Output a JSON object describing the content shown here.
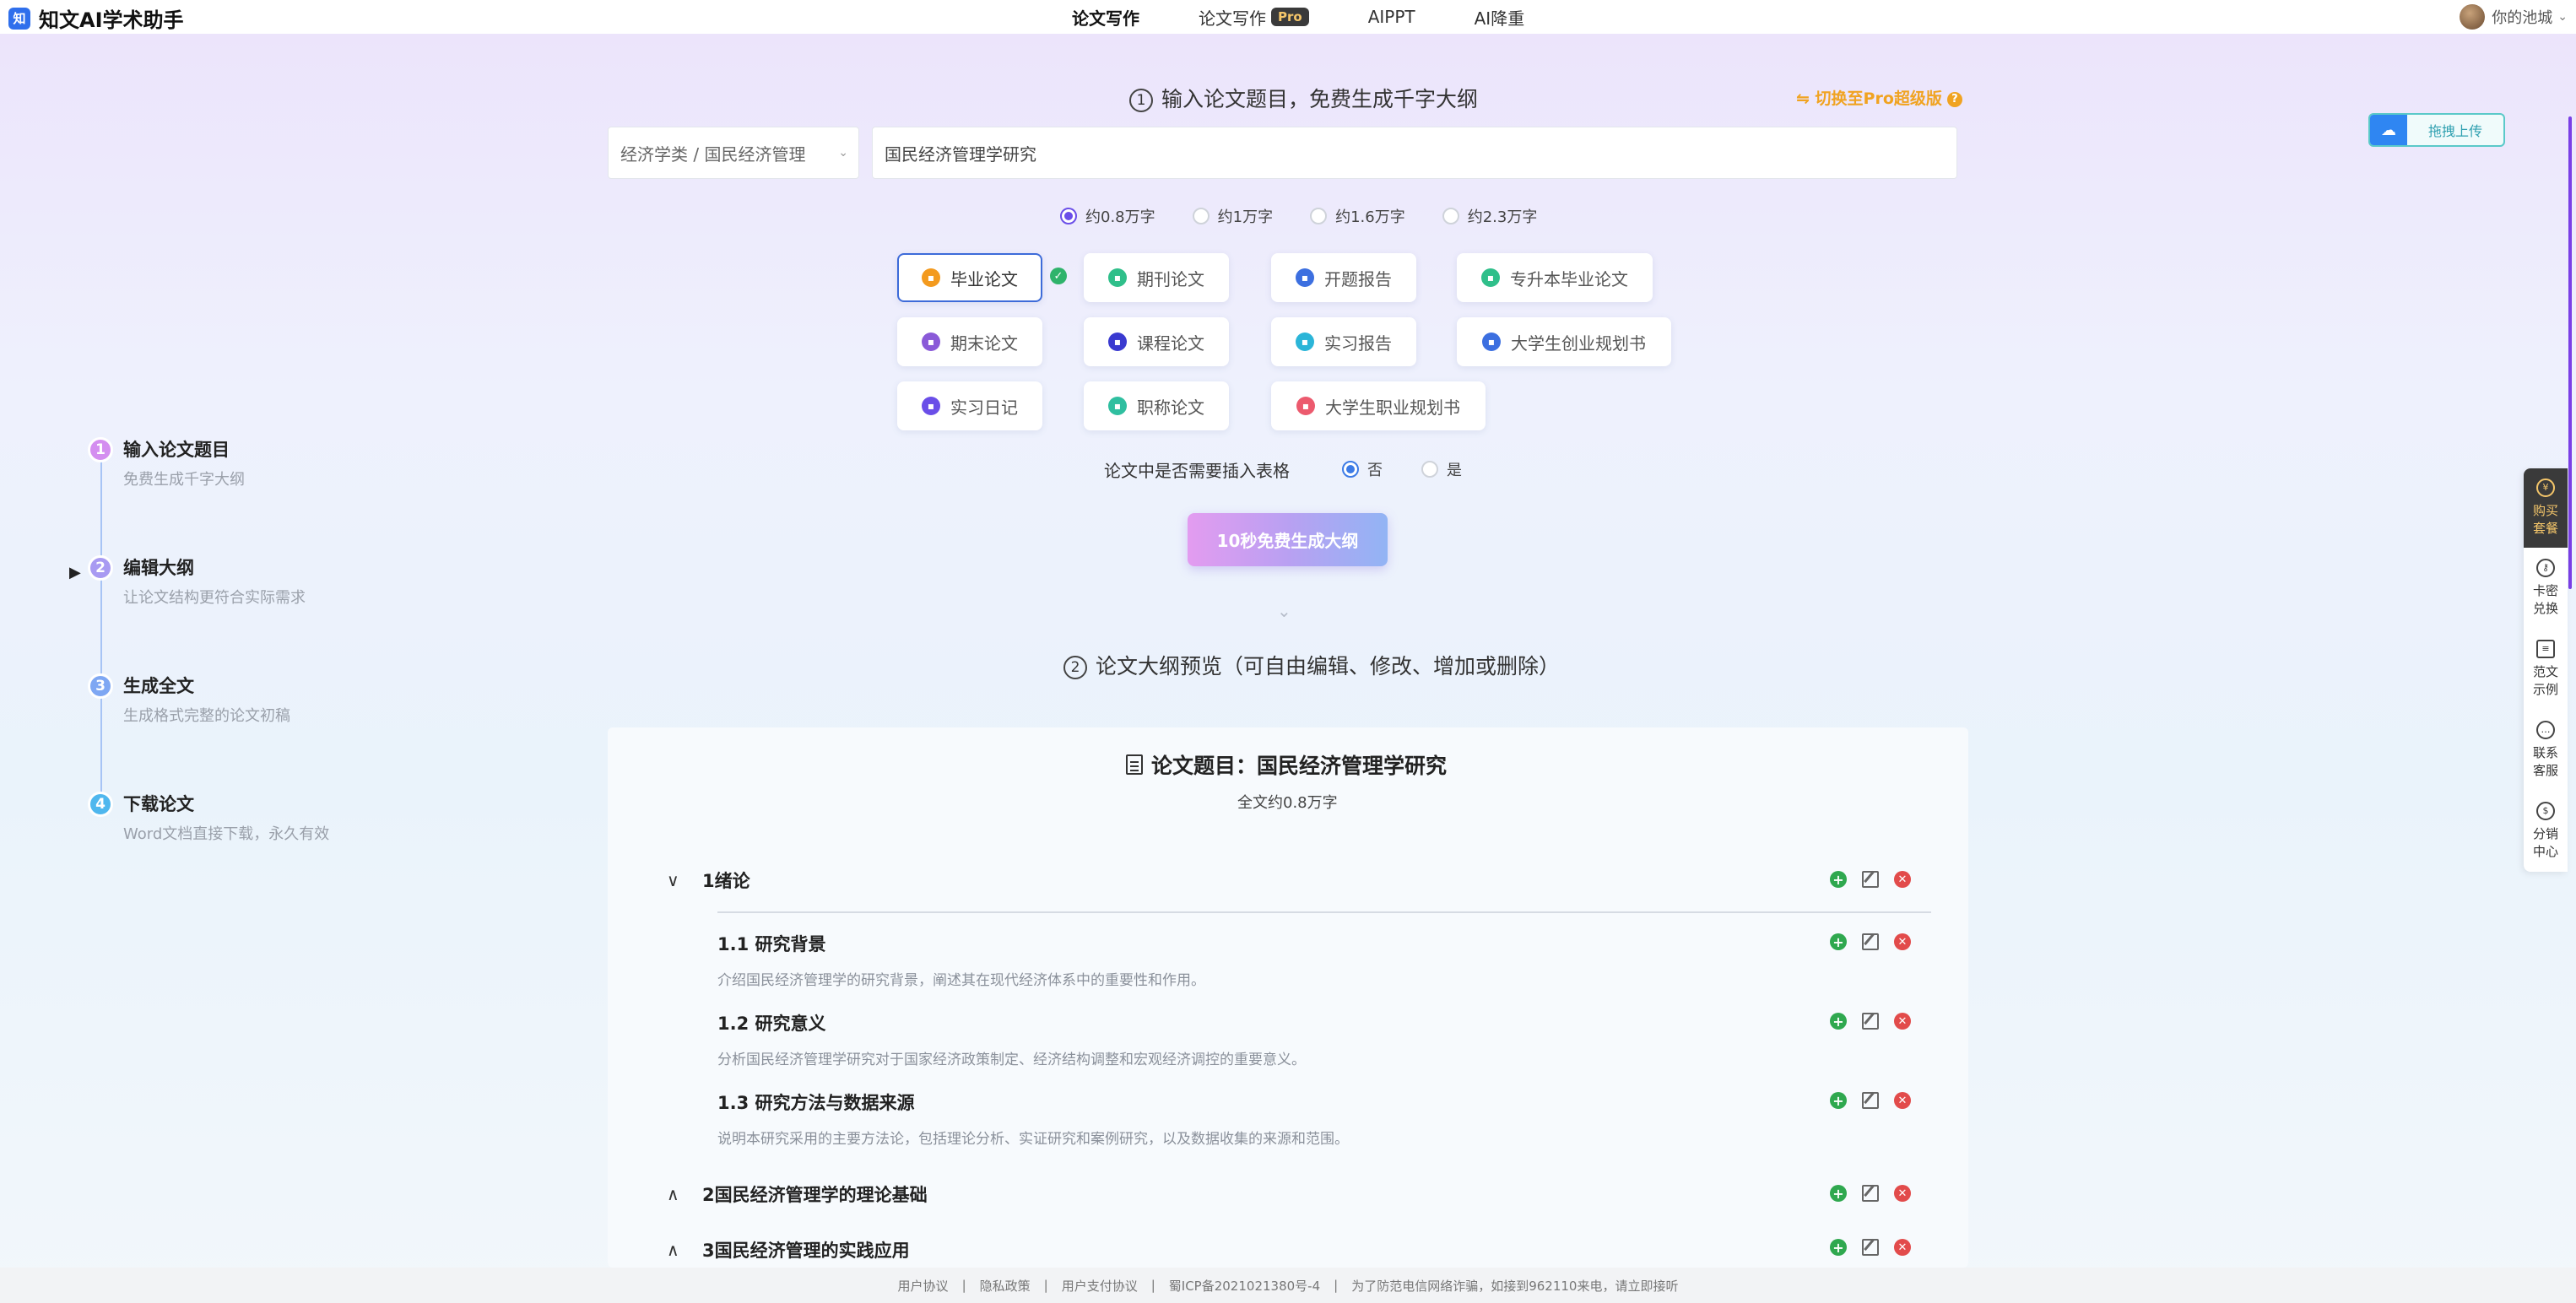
{
  "brand": {
    "logo_glyph": "知",
    "name": "知文AI学术助手",
    "accent": "#2f6fec"
  },
  "nav": [
    {
      "label": "论文写作",
      "active": true
    },
    {
      "label": "论文写作",
      "badge": "Pro"
    },
    {
      "label": "AIPPT"
    },
    {
      "label": "AI降重"
    }
  ],
  "user": {
    "name": "你的池城"
  },
  "steps": [
    {
      "num": "1",
      "title": "输入论文题目",
      "desc": "免费生成千字大纲",
      "color": "#d48ef0"
    },
    {
      "num": "2",
      "title": "编辑大纲",
      "desc": "让论文结构更符合实际需求",
      "color": "#a89af2"
    },
    {
      "num": "3",
      "title": "生成全文",
      "desc": "生成格式完整的论文初稿",
      "color": "#7ea7f3"
    },
    {
      "num": "4",
      "title": "下载论文",
      "desc": "Word文档直接下载，永久有效",
      "color": "#4fb7ee"
    }
  ],
  "step1": {
    "num": "1",
    "title": "输入论文题目，免费生成千字大纲",
    "pro_switch": "切换至Pro超级版",
    "pro_help": "?",
    "subject": "经济学类 / 国民经济管理",
    "topic_value": "国民经济管理学研究",
    "lengths": [
      {
        "label": "约0.8万字",
        "selected": true
      },
      {
        "label": "约1万字"
      },
      {
        "label": "约1.6万字"
      },
      {
        "label": "约2.3万字"
      }
    ],
    "types": [
      {
        "label": "毕业论文",
        "color": "#f39a1e",
        "selected": true
      },
      {
        "label": "期刊论文",
        "color": "#2fbf8a"
      },
      {
        "label": "开题报告",
        "color": "#3c6fe0"
      },
      {
        "label": "专升本毕业论文",
        "color": "#2fbf8a"
      },
      {
        "label": "期末论文",
        "color": "#8a5ad8"
      },
      {
        "label": "课程论文",
        "color": "#3a3ad0"
      },
      {
        "label": "实习报告",
        "color": "#2bb5d8"
      },
      {
        "label": "大学生创业规划书",
        "color": "#3c6fe0"
      },
      {
        "label": "实习日记",
        "color": "#6a4ee8"
      },
      {
        "label": "职称论文",
        "color": "#2fbfa0"
      },
      {
        "label": "大学生职业规划书",
        "color": "#ec5a6e"
      }
    ],
    "table_question": "论文中是否需要插入表格",
    "table_options": [
      {
        "label": "否",
        "selected": true
      },
      {
        "label": "是"
      }
    ],
    "generate_button": "10秒免费生成大纲"
  },
  "step2": {
    "num": "2",
    "title": "论文大纲预览（可自由编辑、修改、增加或删除）",
    "doc_title": "论文题目：国民经济管理学研究",
    "doc_sub": "全文约0.8万字",
    "chapters": [
      {
        "title": "1绪论",
        "expanded": true,
        "sections": [
          {
            "title": "1.1 研究背景",
            "desc": "介绍国民经济管理学的研究背景，阐述其在现代经济体系中的重要性和作用。"
          },
          {
            "title": "1.2 研究意义",
            "desc": "分析国民经济管理学研究对于国家经济政策制定、经济结构调整和宏观经济调控的重要意义。"
          },
          {
            "title": "1.3 研究方法与数据来源",
            "desc": "说明本研究采用的主要方法论，包括理论分析、实证研究和案例研究，以及数据收集的来源和范围。"
          }
        ]
      },
      {
        "title": "2国民经济管理学的理论基础",
        "expanded": false
      },
      {
        "title": "3国民经济管理的实践应用",
        "expanded": false
      }
    ]
  },
  "upload": {
    "label": "拖拽上传"
  },
  "sidebar": [
    {
      "label": "购买套餐",
      "icon": "buy-icon"
    },
    {
      "label": "卡密兑换",
      "icon": "key-icon"
    },
    {
      "label": "范文示例",
      "icon": "document-icon"
    },
    {
      "label": "联系客服",
      "icon": "chat-icon"
    },
    {
      "label": "分销中心",
      "icon": "money-bag-icon"
    }
  ],
  "footer": [
    "用户协议",
    "|",
    "隐私政策",
    "|",
    "用户支付协议",
    "|",
    "蜀ICP备2021021380号-4",
    "|",
    "为了防范电信网络诈骗，如接到962110来电，请立即接听"
  ]
}
